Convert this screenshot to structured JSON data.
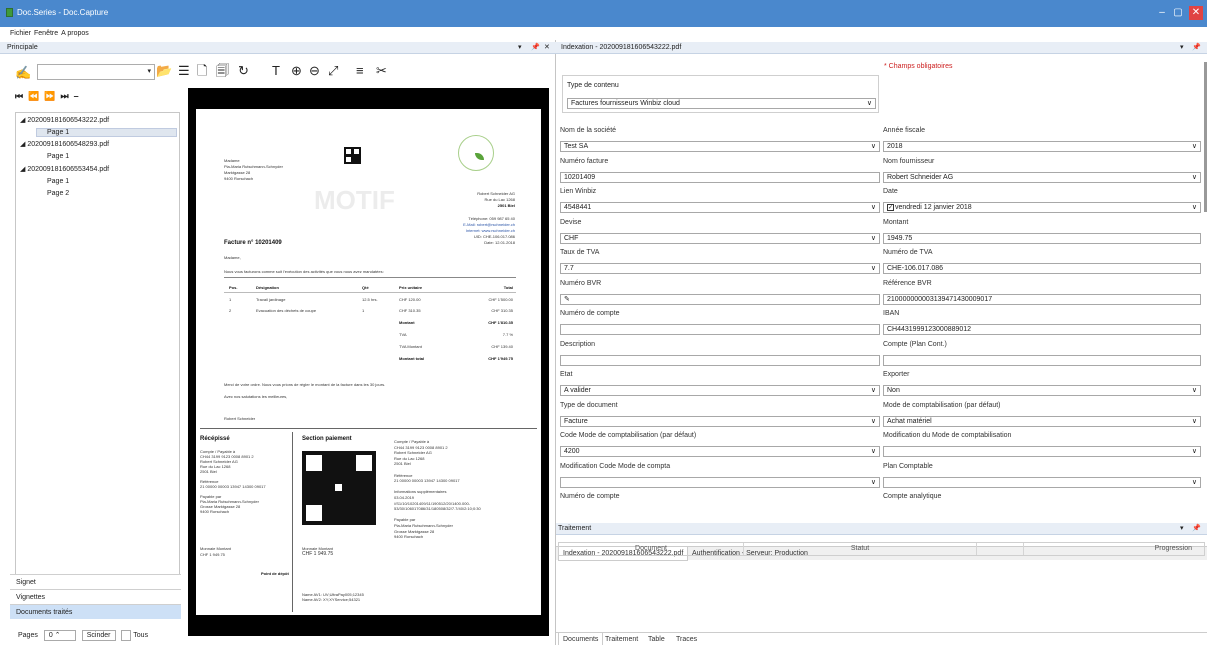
{
  "window": {
    "title": "Doc.Series - Doc.Capture",
    "controls": [
      "–",
      "▢",
      "✕"
    ]
  },
  "menu": [
    "Fichier",
    "Fenêtre",
    "A propos"
  ],
  "left": {
    "header": "Principale",
    "header_controls": [
      "▾",
      "📌",
      "✕"
    ],
    "nav_buttons": [
      "⏮",
      "⏪",
      "⏩",
      "⏭",
      "–"
    ],
    "tree": [
      {
        "label": "202009181606543222.pdf",
        "indent": 0
      },
      {
        "label": "Page 1",
        "indent": 1,
        "selected": true
      },
      {
        "label": "202009181606548293.pdf",
        "indent": 0
      },
      {
        "label": "Page 1",
        "indent": 1
      },
      {
        "label": "202009181606553454.pdf",
        "indent": 0
      },
      {
        "label": "Page 1",
        "indent": 1
      },
      {
        "label": "Page 2",
        "indent": 1
      }
    ],
    "bottom_items": [
      {
        "label": "Signet",
        "selected": false
      },
      {
        "label": "Vignettes",
        "selected": false
      },
      {
        "label": "Documents traités",
        "selected": true
      }
    ],
    "pages_label": "Pages",
    "pages_value": "0",
    "split_label": "Scinder",
    "all_label": "Tous"
  },
  "document": {
    "recipient": [
      "Madame",
      "Pia-Maria Rutschmann-Schnyder",
      "Marktgasse 28",
      "9400 Rorschach"
    ],
    "sender": [
      "Robert Schneider AG",
      "Rue du Lac 1268",
      "2501 Biel"
    ],
    "watermark": "MOTIF",
    "contacts": [
      "Téléphone: 059 987 65 40",
      "E-Mail: robert@rschneider.ch",
      "Internet: www.rschneider.ch",
      "UID: CHE-106.017.086",
      "Date: 12.01.2018"
    ],
    "invoice_title": "Facture n° 10201409",
    "greeting": "Madame,",
    "intro": "Nous vous facturons comme suit l'exécution des activités que vous nous avez mandatées:",
    "table_headers": [
      "Pos.",
      "Désignation",
      "Qté",
      "Prix unitaire",
      "Total"
    ],
    "rows": [
      [
        "1",
        "Travail jardinage",
        "12.5 hrs.",
        "CHF 120.00",
        "CHF 1'500.00"
      ],
      [
        "2",
        "Evacuation des déchets de coupe",
        "1",
        "CHF 310.35",
        "CHF 310.35"
      ]
    ],
    "totals": [
      [
        "Montant",
        "CHF 1'810.35"
      ],
      [
        "TVA",
        "7.7 %"
      ],
      [
        "TVA Montant",
        "CHF 139.40"
      ],
      [
        "Montant total",
        "CHF 1'949.75"
      ]
    ],
    "closing": [
      "Merci de votre ordre. Nous vous prions de régler le montant de la facture dans les 30 jours.",
      "Avec nos salutations les meilleures,",
      "",
      "Robert Schneider"
    ],
    "receipt_title": "Récépissé",
    "payment_title": "Section paiement",
    "receipt_lines": [
      "Compte / Payable à",
      "CH44 3199 9123 0008 8901 2",
      "Robert Schneider AG",
      "Rue du Lac 1268",
      "2501 Biel",
      "",
      "Référence",
      "21 00000 00003 13947 14300 09017",
      "",
      "Payable par",
      "Pia-Maria Rutschmann-Schnyder",
      "Grosse Marktgasse 28",
      "9400 Rorschach"
    ],
    "receipt_amount": [
      "Monnaie  Montant",
      "CHF     1 949.75"
    ],
    "receipt_depot": "Point de dépôt",
    "payment_lines": [
      "Compte / Payable à",
      "CH44 3199 9123 0008 8901 2",
      "Robert Schneider AG",
      "Rue du Lac 1268",
      "2501 Biel",
      "",
      "Référence",
      "21 00000 00003 13947 14300 09017",
      "",
      "Informations supplémentaires",
      "03.04.2019",
      "//S1/10/10201409/11/190512/20/1400.000-",
      "53/30/106017086/31/180508/32/7.7/40/2:10;0:30",
      "",
      "Payable par",
      "Pia-Maria Rutschmann-Schnyder",
      "Grosse Marktgasse 28",
      "9400 Rorschach"
    ],
    "payment_amount": [
      "Monnaie  Montant",
      "CHF     1 949.75"
    ],
    "payment_names": [
      "Name AV1: UV;UltraPay005;12345",
      "Name AV2: XY;XYService;54321"
    ]
  },
  "right": {
    "header": "Indexation - 202009181606543222.pdf",
    "header_controls": [
      "▾",
      "📌"
    ],
    "required_note": "* Champs obligatoires",
    "content_type_label": "Type de contenu",
    "content_type_value": "Factures fournisseurs Winbiz cloud",
    "fields_left": [
      {
        "label": "Nom de la société",
        "value": "Test SA",
        "dropdown": true
      },
      {
        "label": "Numéro facture",
        "value": "10201409",
        "dropdown": false
      },
      {
        "label": "Lien Winbiz",
        "value": "4548441",
        "dropdown": true
      },
      {
        "label": "Devise",
        "value": "CHF",
        "dropdown": true
      },
      {
        "label": "Taux de TVA",
        "value": "7.7",
        "dropdown": true
      },
      {
        "label": "Numéro BVR",
        "value": "",
        "dropdown": false,
        "pen": true
      },
      {
        "label": "Numéro de compte",
        "value": "",
        "dropdown": false
      },
      {
        "label": "Description",
        "value": "",
        "dropdown": false
      },
      {
        "label": "Etat",
        "value": "A valider",
        "dropdown": true
      },
      {
        "label": "Type de document",
        "value": "Facture",
        "dropdown": true
      },
      {
        "label": "Code Mode de comptabilisation (par défaut)",
        "value": "4200",
        "dropdown": true
      },
      {
        "label": "Modification Code Mode de compta",
        "value": "",
        "dropdown": true
      },
      {
        "label": "Numéro de compte",
        "value": "",
        "dropdown": false
      }
    ],
    "fields_right": [
      {
        "label": "Année fiscale",
        "value": "2018",
        "dropdown": true
      },
      {
        "label": "Nom fournisseur",
        "value": "Robert Schneider AG",
        "dropdown": true
      },
      {
        "label": "Date",
        "value": "vendredi 12 janvier 2018",
        "dropdown": true,
        "checkbox": true
      },
      {
        "label": "Montant",
        "value": "1949.75",
        "dropdown": false
      },
      {
        "label": "Numéro de TVA",
        "value": "CHE-106.017.086",
        "dropdown": false
      },
      {
        "label": "Référence BVR",
        "value": "210000000003139471430009017",
        "dropdown": false
      },
      {
        "label": "IBAN",
        "value": "CH4431999123000889012",
        "dropdown": false
      },
      {
        "label": "Compte (Plan Cont.)",
        "value": "",
        "dropdown": false
      },
      {
        "label": "Exporter",
        "value": "Non",
        "dropdown": true
      },
      {
        "label": "Mode de comptabilisation (par défaut)",
        "value": "Achat matériel",
        "dropdown": true
      },
      {
        "label": "Modification du Mode de comptabilisation",
        "value": "",
        "dropdown": true
      },
      {
        "label": "Plan Comptable",
        "value": "",
        "dropdown": true
      },
      {
        "label": "Compte analytique",
        "value": "",
        "dropdown": false
      }
    ],
    "tabs_top": [
      "Indexation - 202009181606543222.pdf",
      "Authentification - Serveur: Production"
    ],
    "traitement_header": "Traitement",
    "columns": [
      "Document",
      "Statut",
      "",
      "Progression"
    ],
    "tabs_bottom": [
      "Documents",
      "Traitement",
      "Table",
      "Traces"
    ]
  }
}
